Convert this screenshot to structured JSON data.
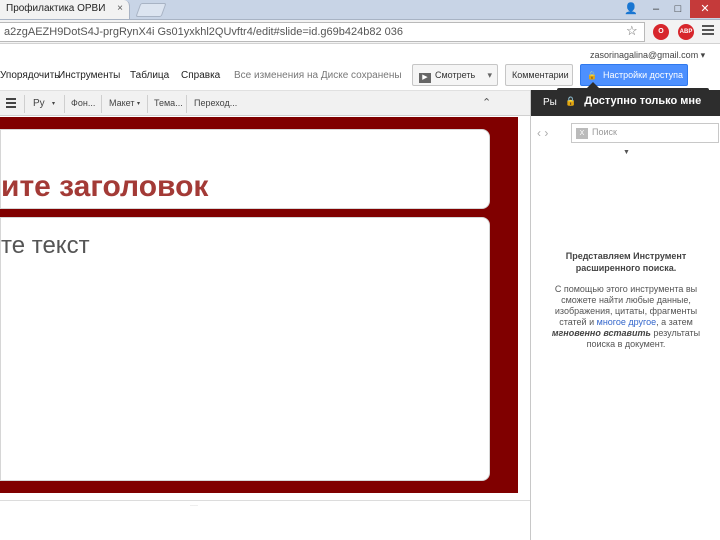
{
  "browser": {
    "tab_title": "Профилактика ОРВИ",
    "tab_close": "×",
    "url": "a2zgAEZH9DotS4J-prgRynX4i Gs01yxkhl2QUvftr4/edit#slide=id.g69b424b82 036",
    "window_controls": {
      "user": "👤",
      "minimize": "–",
      "maximize": "□",
      "close": "✕"
    },
    "star_glyph": "☆",
    "ext_opera": "O",
    "ext_abp": "ABP"
  },
  "docs": {
    "account": "zasorinagalina@gmail.com ▾",
    "menu": [
      "Упорядочить",
      "Инструменты",
      "Таблица",
      "Справка"
    ],
    "saved_status": "Все изменения на Диске сохранены",
    "present_label": "Смотреть",
    "present_caret": "▾",
    "play_glyph": "▶",
    "comments_label": "Комментарии",
    "share_label": "Настройки доступа",
    "lock_glyph": "🔒",
    "tooltip": "Доступно только мне"
  },
  "toolbar": {
    "lang": "Ру",
    "lang_caret": "▾",
    "background": "Фон...",
    "layout": "Макет",
    "layout_caret": "▾",
    "theme": "Тема...",
    "transition": "Переход...",
    "collapse_glyph": "⌃"
  },
  "side_panel": {
    "heading": "Ры",
    "nav": "‹  ›",
    "search_placeholder": "Поиск",
    "x_glyph": "X",
    "filter_caret": "▼",
    "intro_title": "Представляем Инструмент расширенного поиска.",
    "intro_body_1": "С помощью этого инструмента вы сможете найти любые данные, изображения, цитаты, фрагменты статей и ",
    "intro_link": "многое другое",
    "intro_body_2": ", а затем ",
    "intro_em": "мгновенно вставить",
    "intro_body_3": " результаты поиска в документ."
  },
  "slide": {
    "title": "ите заголовок",
    "body": "те текст"
  },
  "notes": {
    "handle": "····"
  }
}
